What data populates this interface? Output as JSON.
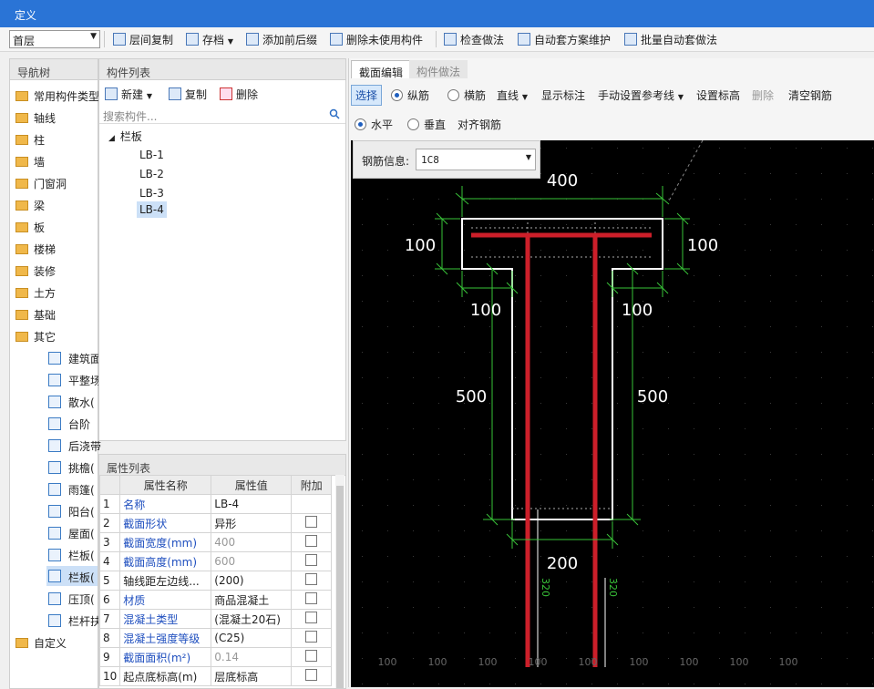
{
  "window": {
    "title": "定义"
  },
  "toolbar": {
    "floor": "首层",
    "items": [
      "层间复制",
      "存档",
      "添加前后缀",
      "删除未使用构件",
      "检查做法",
      "自动套方案维护",
      "批量自动套做法"
    ]
  },
  "nav": {
    "title": "导航树",
    "items": [
      "常用构件类型",
      "轴线",
      "柱",
      "墙",
      "门窗洞",
      "梁",
      "板",
      "楼梯",
      "装修",
      "土方",
      "基础",
      "其它"
    ],
    "sub_items": [
      "建筑面",
      "平整场",
      "散水(",
      "台阶",
      "后浇带",
      "挑檐(",
      "雨篷(",
      "阳台(",
      "屋面(",
      "栏板(",
      "压顶(",
      "栏杆扶"
    ],
    "last": "自定义"
  },
  "components": {
    "title": "构件列表",
    "new": "新建",
    "copy": "复制",
    "delete": "删除",
    "search_placeholder": "搜索构件...",
    "root": "栏板",
    "items": [
      "LB-1",
      "LB-2",
      "LB-3",
      "LB-4"
    ],
    "selected": "LB-4"
  },
  "properties": {
    "title": "属性列表",
    "headers": [
      "属性名称",
      "属性值",
      "附加"
    ],
    "rows": [
      {
        "n": "1",
        "name": "名称",
        "value": "LB-4"
      },
      {
        "n": "2",
        "name": "截面形状",
        "value": "异形"
      },
      {
        "n": "3",
        "name": "截面宽度(mm)",
        "value": "400"
      },
      {
        "n": "4",
        "name": "截面高度(mm)",
        "value": "600"
      },
      {
        "n": "5",
        "name": "轴线距左边线...",
        "value": "(200)"
      },
      {
        "n": "6",
        "name": "材质",
        "value": "商品混凝土"
      },
      {
        "n": "7",
        "name": "混凝土类型",
        "value": "(混凝土20石)"
      },
      {
        "n": "8",
        "name": "混凝土强度等级",
        "value": "(C25)"
      },
      {
        "n": "9",
        "name": "截面面积(m²)",
        "value": "0.14"
      },
      {
        "n": "10",
        "name": "起点底标高(m)",
        "value": "层底标高"
      }
    ]
  },
  "editor": {
    "tabs": [
      "截面编辑",
      "构件做法"
    ],
    "row1": {
      "select": "选择",
      "long": "纵筋",
      "trans": "横筋",
      "line": "直线",
      "show": "显示标注",
      "ref": "手动设置参考线",
      "elev": "设置标高",
      "del": "删除",
      "clear": "清空钢筋"
    },
    "row2": {
      "horiz": "水平",
      "vert": "垂直",
      "align": "对齐钢筋"
    },
    "rebar_label": "钢筋信息:",
    "rebar_value": "1C8"
  },
  "drawing": {
    "dims": {
      "top": "400",
      "left_h": "100",
      "right_h": "100",
      "left_step": "100",
      "right_step": "100",
      "left_web": "500",
      "right_web": "500",
      "bottom": "200"
    },
    "rebar_len": "320",
    "grid_label": "100",
    "colors": {
      "outline": "#ffffff",
      "rebar": "#cc1f2a",
      "dim": "#39c339"
    }
  }
}
